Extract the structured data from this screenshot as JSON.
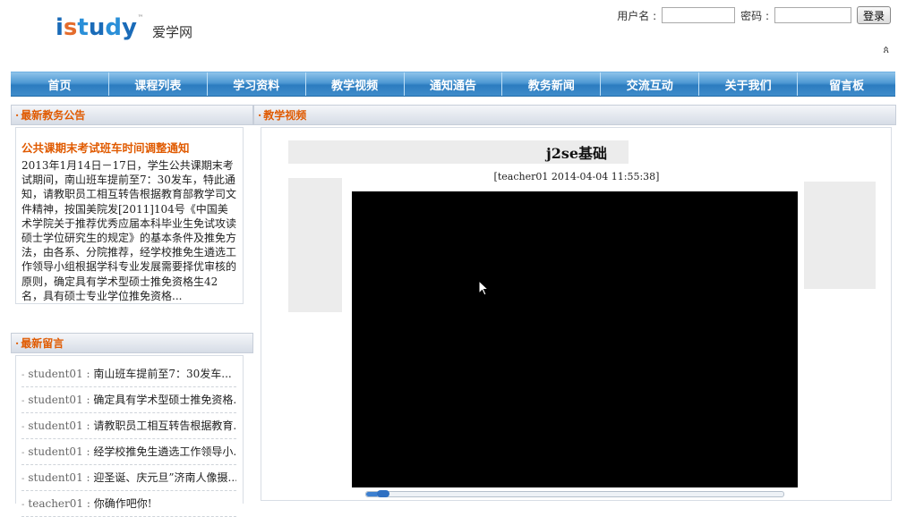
{
  "header": {
    "logo_text": "istudy",
    "logo_tm": "™",
    "logo_cn": "爱学网",
    "login": {
      "username_label": "用户名 :",
      "password_label": "密码 :",
      "username_value": "",
      "password_value": "",
      "login_button": "登录"
    },
    "small_mark": "ጰ"
  },
  "nav": {
    "items": [
      "首页",
      "课程列表",
      "学习资料",
      "教学视频",
      "通知通告",
      "教务新闻",
      "交流互动",
      "关于我们",
      "留言板"
    ]
  },
  "notice": {
    "header": "最新教务公告",
    "title": "公共课期末考试班车时间调整通知",
    "text": "2013年1月14日－17日，学生公共课期末考试期间，南山班车提前至7：30发车，特此通知，请教职员工相互转告根据教育部教学司文件精神，按国美院发[2011]104号《中国美术学院关于推荐优秀应届本科毕业生免试攻读硕士学位研究生的规定》的基本条件及推免方法，由各系、分院推荐，经学校推免生遴选工作领导小组根据学科专业发展需要择优审核的原则，确定具有学术型硕士推免资格生42名，具有硕士专业学位推免资格..."
  },
  "messages": {
    "header": "最新留言",
    "items": [
      {
        "user": "student01",
        "content": "南山班车提前至7：30发车..."
      },
      {
        "user": "student01",
        "content": "确定具有学术型硕士推免资格..."
      },
      {
        "user": "student01",
        "content": "请教职员工相互转告根据教育..."
      },
      {
        "user": "student01",
        "content": "经学校推免生遴选工作领导小..."
      },
      {
        "user": "student01",
        "content": "迎圣诞、庆元旦”济南人像摄..."
      },
      {
        "user": "teacher01",
        "content": "你确作吧你!"
      }
    ]
  },
  "main": {
    "header": "教学视频",
    "video_title": "j2se基础",
    "meta": "[teacher01   2014-04-04 11:55:38]",
    "progress": 0.03
  },
  "colors": {
    "nav_blue": "#2c7cc0",
    "accent_orange": "#e05a00",
    "player_bg": "#000000"
  }
}
